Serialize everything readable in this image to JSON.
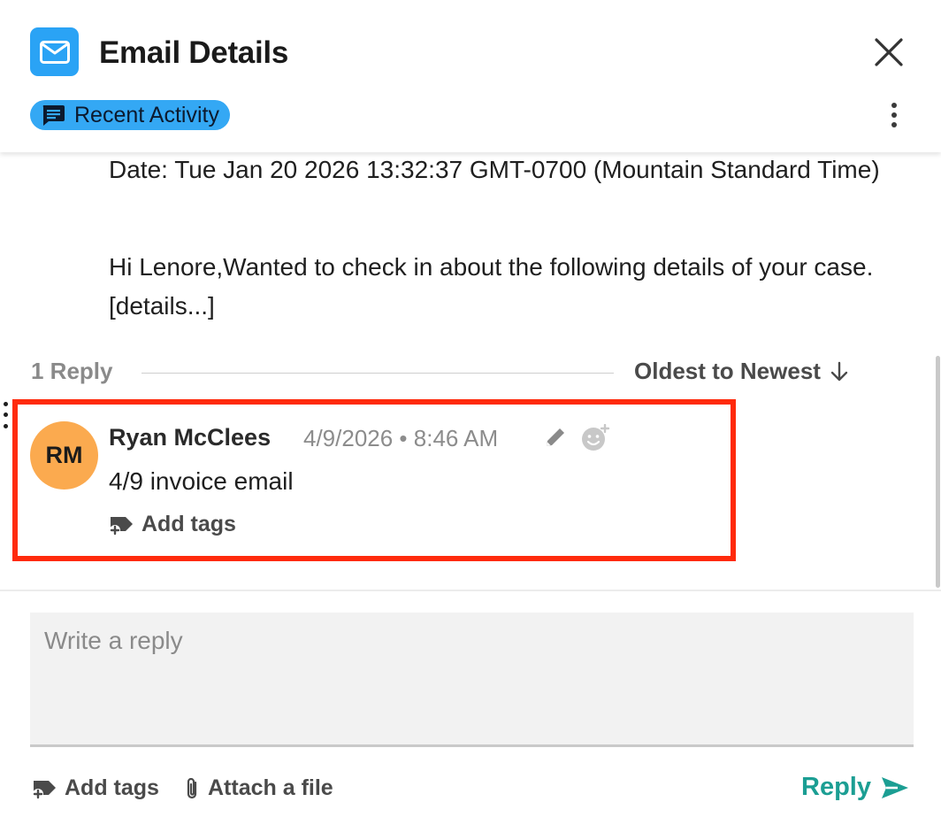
{
  "header": {
    "title": "Email Details",
    "activity_pill": "Recent Activity",
    "icon": "mail-icon",
    "accent_color": "#2aa3f5"
  },
  "email": {
    "date_line": "Date: Tue Jan 20 2026 13:32:37 GMT-0700 (Mountain Standard Time)",
    "body": "Hi Lenore,Wanted to check in about the following details of your case.[details...]"
  },
  "replies": {
    "count_label": "1 Reply",
    "sort_label": "Oldest to Newest"
  },
  "comment": {
    "avatar_initials": "RM",
    "avatar_color": "#fbaa4f",
    "author": "Ryan McClees",
    "timestamp": "4/9/2026 • 8:46 AM",
    "text": "4/9 invoice email",
    "add_tags_label": "Add tags",
    "highlight_color": "#ff2a0c"
  },
  "composer": {
    "placeholder": "Write a reply",
    "value": "",
    "add_tags_label": "Add tags",
    "attach_label": "Attach a file",
    "reply_label": "Reply",
    "reply_color": "#1b9e93"
  }
}
